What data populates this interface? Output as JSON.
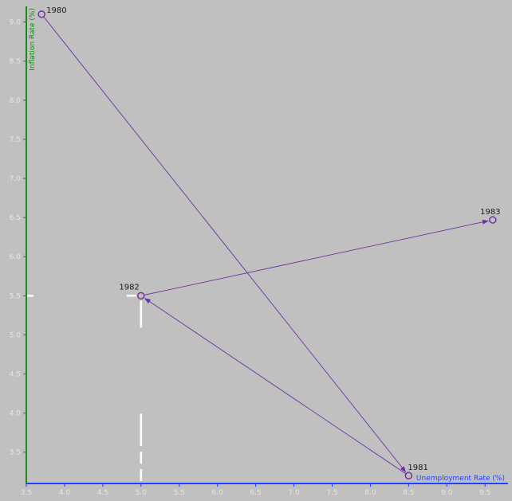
{
  "chart_data": {
    "type": "scatter",
    "xlabel": "Unemployment Rate (%)",
    "ylabel": "Inflation Rate (%)",
    "xlim": [
      3.5,
      9.8
    ],
    "ylim": [
      3.1,
      9.2
    ],
    "x_ticks": [
      "3.5",
      "4.0",
      "4.5",
      "5.0",
      "5.5",
      "6.0",
      "6.5",
      "7.0",
      "7.5",
      "8.0",
      "8.5",
      "9.0",
      "9.5"
    ],
    "y_ticks": [
      "3.5",
      "4.0",
      "4.5",
      "5.0",
      "5.5",
      "6.0",
      "6.5",
      "7.0",
      "7.5",
      "8.0",
      "8.5",
      "9.0"
    ],
    "x_tick_values": [
      3.5,
      4.0,
      4.5,
      5.0,
      5.5,
      6.0,
      6.5,
      7.0,
      7.5,
      8.0,
      8.5,
      9.0,
      9.5
    ],
    "y_tick_values": [
      3.5,
      4.0,
      4.5,
      5.0,
      5.5,
      6.0,
      6.5,
      7.0,
      7.5,
      8.0,
      8.5,
      9.0
    ],
    "points": [
      {
        "label": "1980",
        "x": 3.7,
        "y": 9.1
      },
      {
        "label": "1981",
        "x": 8.5,
        "y": 3.2
      },
      {
        "label": "1982",
        "x": 5.0,
        "y": 5.5
      },
      {
        "label": "1983",
        "x": 9.6,
        "y": 6.47
      }
    ],
    "highlight": {
      "x": 5.0,
      "y": 5.5
    },
    "grid": false,
    "colors": {
      "series": "#7030a0",
      "x_axis": "#2040ff",
      "y_axis": "#1a8a1a",
      "highlight": "#ffffff",
      "tick_label": "#e6e6e6"
    }
  }
}
